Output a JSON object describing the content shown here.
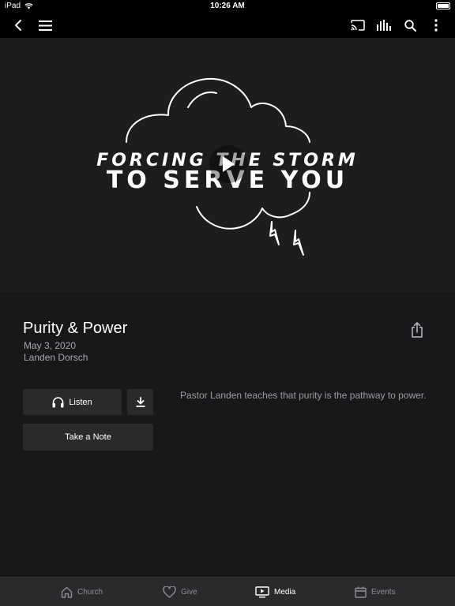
{
  "status_bar": {
    "carrier": "iPad",
    "time": "10:26 AM"
  },
  "hero": {
    "line1": "FORCING THE STORM",
    "line2": "TO SERVE YOU"
  },
  "sermon": {
    "title": "Purity & Power",
    "date": "May 3, 2020",
    "speaker": "Landen Dorsch",
    "description": "Pastor Landen teaches that purity is the pathway to power."
  },
  "actions": {
    "listen_label": "Listen",
    "note_label": "Take a Note"
  },
  "tabs": [
    {
      "label": "Church",
      "icon": "home-icon",
      "active": false
    },
    {
      "label": "Give",
      "icon": "heart-icon",
      "active": false
    },
    {
      "label": "Media",
      "icon": "media-icon",
      "active": true
    },
    {
      "label": "Events",
      "icon": "calendar-icon",
      "active": false
    }
  ],
  "colors": {
    "background": "#18181a",
    "hero_bg": "#1d1d1e",
    "button_bg": "#2a2a2c",
    "secondary_text": "#a8a8ac"
  }
}
